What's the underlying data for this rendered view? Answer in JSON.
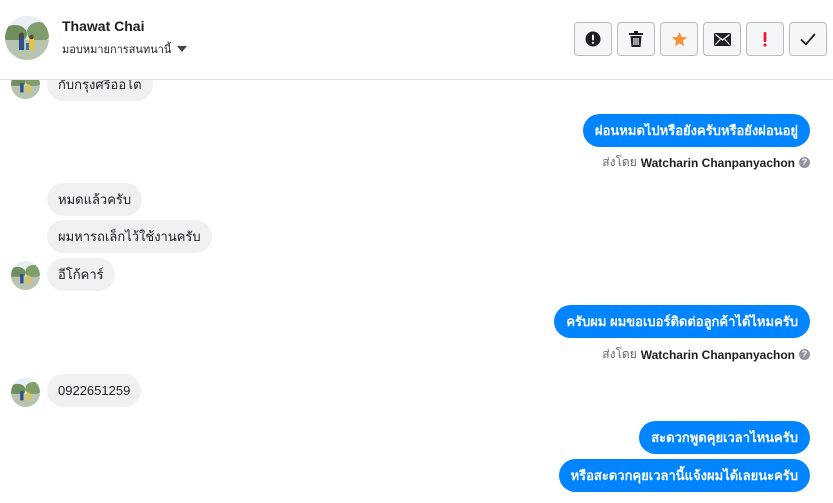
{
  "header": {
    "contact_name": "Thawat Chai",
    "assign_label": "มอบหมายการสนทนานี้",
    "actions": [
      {
        "name": "report-spam",
        "icon": "exclamation-circle-icon"
      },
      {
        "name": "delete",
        "icon": "trash-icon"
      },
      {
        "name": "star",
        "icon": "star-icon"
      },
      {
        "name": "mark-unread",
        "icon": "envelope-icon"
      },
      {
        "name": "follow-up",
        "icon": "exclamation-icon"
      },
      {
        "name": "mark-done",
        "icon": "checkmark-icon"
      }
    ]
  },
  "thread": {
    "messages": [
      {
        "dir": "in",
        "text": "กับกรุงศรีออโต"
      },
      {
        "dir": "out",
        "text": "ผ่อนหมดไปหรือยังครับหรือยังผ่อนอยู่"
      },
      {
        "dir": "in",
        "text": "หมดแล้วครับ"
      },
      {
        "dir": "in",
        "text": "ผมหารถเล็กไว้ใช้งานครับ"
      },
      {
        "dir": "in",
        "text": "อีโก้คาร์"
      },
      {
        "dir": "out",
        "text": "ครับผม ผมขอเบอร์ติดต่อลูกค้าได้ไหมครับ"
      },
      {
        "dir": "in",
        "text": "0922651259"
      },
      {
        "dir": "out",
        "text": "สะดวกพูดคุยเวลาไหนครับ"
      },
      {
        "dir": "out",
        "text": "หรือสะดวกคุยเวลานี้แจ้งผมได้เลยนะครับ"
      }
    ],
    "sent_by_label": "ส่งโดย",
    "sent_by_name": "Watcharin Chanpanyachon"
  },
  "colors": {
    "outgoing_bubble": "#0084ff",
    "incoming_bubble": "#eff0f2",
    "star_accent": "#f7923a",
    "follow_up_red": "#e41e3f"
  }
}
